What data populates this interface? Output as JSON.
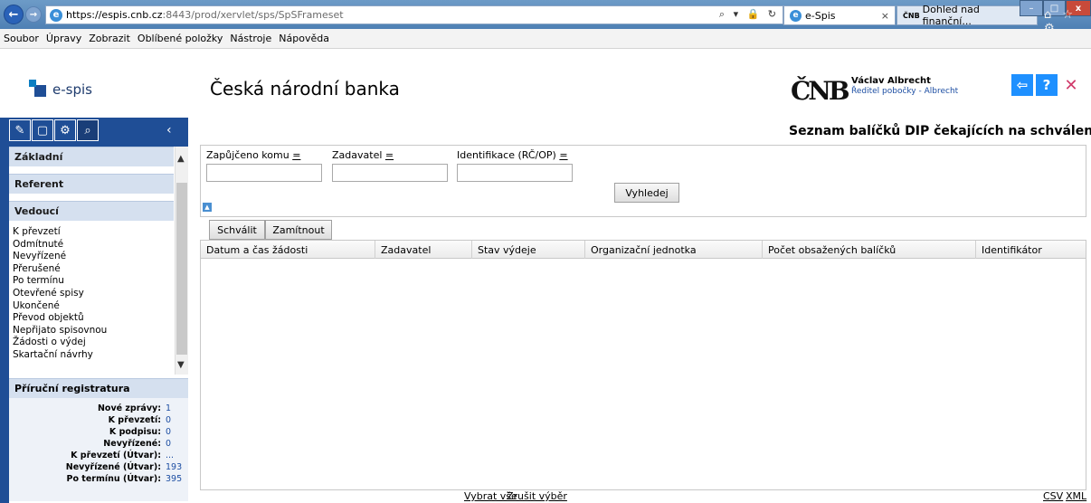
{
  "browser": {
    "url_host": "https://espis.cnb.cz",
    "url_path": ":8443/prod/xervlet/sps/SpSFrameset",
    "address_icons": "⌕ ▾ 🔒 ↻",
    "tabs": [
      {
        "label": "e-Spis",
        "close": "×"
      },
      {
        "label": "Dohled nad finanční...",
        "icon_text": "ČNB"
      }
    ],
    "window_controls": {
      "minimize": "–",
      "maximize": "□",
      "close": "x"
    },
    "chrome_icons": "⌂ ☆ ⚙"
  },
  "menu": {
    "items": [
      "Soubor",
      "Úpravy",
      "Zobrazit",
      "Oblíbené položky",
      "Nástroje",
      "Nápověda"
    ]
  },
  "header": {
    "app_name": "e-spis",
    "bank_title": "Česká národní banka",
    "cnb_logo": "ČNB",
    "user_name": "Václav  Albrecht",
    "user_role": "Ředitel pobočky - Albrecht",
    "buttons": {
      "exit": "⇦",
      "help": "?",
      "close": "✕"
    }
  },
  "sidebar": {
    "tools": [
      "✎",
      "▢",
      "⚙",
      "⌕"
    ],
    "collapse": "‹",
    "sections": {
      "zakladni": "Základní",
      "referent": "Referent",
      "vedouci": "Vedoucí",
      "registratura": "Příruční registratura"
    },
    "vedouci_items": [
      "K převzetí",
      "Odmítnuté",
      "Nevyřízené",
      "Přerušené",
      "Po termínu",
      "Otevřené spisy",
      "Ukončené",
      "Převod objektů",
      "Nepřijato spisovnou",
      "Žádosti o výdej",
      "Skartační návrhy"
    ],
    "registratura": [
      {
        "label": "Nové zprávy:",
        "value": "1"
      },
      {
        "label": "K převzetí:",
        "value": "0"
      },
      {
        "label": "K podpisu:",
        "value": "0"
      },
      {
        "label": "Nevyřízené:",
        "value": "0"
      },
      {
        "label": "K převzetí (Útvar):",
        "value": "..."
      },
      {
        "label": "Nevyřízené (Útvar):",
        "value": "193"
      },
      {
        "label": "Po termínu (Útvar):",
        "value": "395"
      }
    ]
  },
  "main": {
    "heading": "Seznam balíčků DIP čekajících na schválení",
    "filters": {
      "zapujceno": "Zapůjčeno komu",
      "zadavatel": "Zadavatel",
      "identifikace": "Identifikace (RČ/OP)",
      "eq": "=",
      "values": {
        "zapujceno": "",
        "zadavatel": "",
        "identifikace": ""
      }
    },
    "search_button": "Vyhledej",
    "approve_button": "Schválit",
    "reject_button": "Zamítnout",
    "columns": [
      "Datum a čas žádosti",
      "Zadavatel",
      "Stav výdeje",
      "Organizační jednotka",
      "Počet obsažených balíčků",
      "Identifikátor"
    ],
    "rows": [],
    "footer": {
      "select_all": "Vybrat vše",
      "clear": "Zrušit výběr",
      "csv": "CSV",
      "xml": "XML"
    }
  }
}
